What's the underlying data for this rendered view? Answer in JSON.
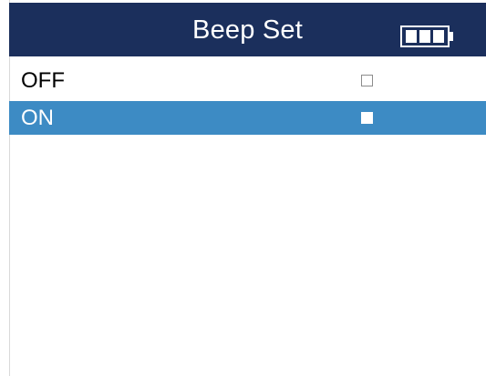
{
  "header": {
    "title": "Beep Set",
    "battery_icon": "battery-full-icon"
  },
  "options": [
    {
      "label": "OFF",
      "checked": false,
      "selected": false
    },
    {
      "label": "ON",
      "checked": true,
      "selected": true
    }
  ],
  "colors": {
    "header_background": "#1b2f5c",
    "selection_highlight": "#3d8bc4",
    "text": "#000000",
    "selected_text": "#ffffff"
  }
}
